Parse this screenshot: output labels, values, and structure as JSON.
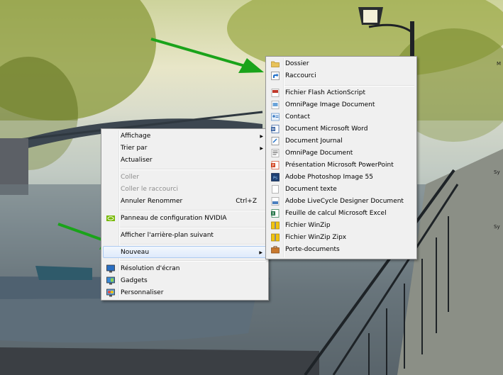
{
  "context_menu": {
    "items": [
      {
        "label": "Affichage",
        "arrow": "▶"
      },
      {
        "label": "Trier par",
        "arrow": "▶"
      },
      {
        "label": "Actualiser"
      },
      {
        "label": "Coller"
      },
      {
        "label": "Coller le raccourci"
      },
      {
        "label": "Annuler Renommer",
        "shortcut": "Ctrl+Z"
      },
      {
        "label": "Panneau de configuration NVIDIA"
      },
      {
        "label": "Afficher l'arrière-plan suivant"
      },
      {
        "label": "Nouveau",
        "arrow": "▶"
      },
      {
        "label": "Résolution d'écran"
      },
      {
        "label": "Gadgets"
      },
      {
        "label": "Personnaliser"
      }
    ]
  },
  "submenu_nouveau": {
    "items": [
      {
        "label": "Dossier",
        "icon": "folder-icon"
      },
      {
        "label": "Raccourci",
        "icon": "shortcut-icon"
      },
      {
        "label": "Fichier Flash ActionScript",
        "icon": "flash-actionscript-icon"
      },
      {
        "label": "OmniPage Image Document",
        "icon": "omnipage-image-icon"
      },
      {
        "label": "Contact",
        "icon": "contact-icon"
      },
      {
        "label": "Document Microsoft Word",
        "icon": "word-icon"
      },
      {
        "label": "Document Journal",
        "icon": "journal-icon"
      },
      {
        "label": "OmniPage Document",
        "icon": "omnipage-document-icon"
      },
      {
        "label": "Présentation Microsoft PowerPoint",
        "icon": "powerpoint-icon"
      },
      {
        "label": "Adobe Photoshop Image 55",
        "icon": "photoshop-icon"
      },
      {
        "label": "Document texte",
        "icon": "text-document-icon"
      },
      {
        "label": "Adobe LiveCycle Designer Document",
        "icon": "livecycle-icon"
      },
      {
        "label": "Feuille de calcul Microsoft Excel",
        "icon": "excel-icon"
      },
      {
        "label": "Fichier WinZip",
        "icon": "winzip-icon"
      },
      {
        "label": "Fichier WinZip Zipx",
        "icon": "winzip-zipx-icon"
      },
      {
        "label": "Porte-documents",
        "icon": "briefcase-icon"
      }
    ]
  },
  "desktop_edge_labels": [
    "M",
    "Sy",
    "Sy"
  ],
  "colors": {
    "menu_bg": "#f0f0f0",
    "highlight_border": "#aecbf1",
    "arrow_green": "#1aa31a"
  }
}
